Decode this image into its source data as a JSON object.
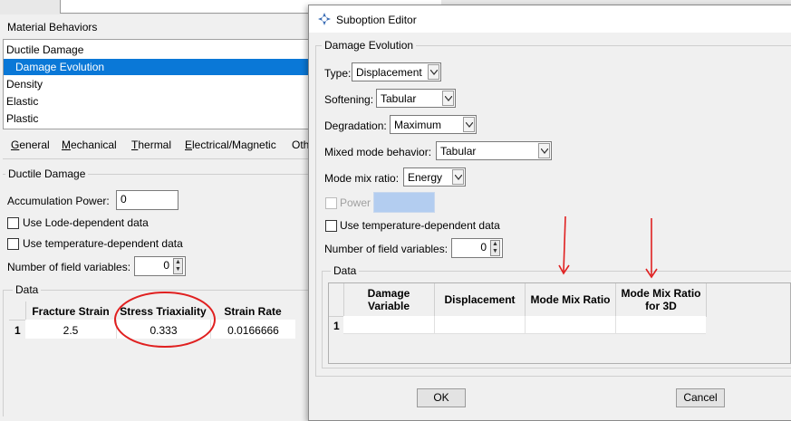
{
  "material": {
    "behaviors_title": "Material Behaviors",
    "behaviors": [
      "Ductile Damage",
      "Damage Evolution",
      "Density",
      "Elastic",
      "Plastic"
    ],
    "selected_index": 1,
    "menus": [
      {
        "u": "G",
        "rest": "eneral"
      },
      {
        "u": "M",
        "rest": "echanical"
      },
      {
        "u": "T",
        "rest": "hermal"
      },
      {
        "u": "E",
        "rest": "lectrical/Magnetic"
      },
      {
        "u": "",
        "rest": "Oth"
      }
    ],
    "section_title": "Ductile Damage",
    "accumulation_label": "Accumulation Power:",
    "accumulation_value": "0",
    "lode_label": "Use Lode-dependent data",
    "temp_label": "Use temperature-dependent data",
    "field_vars_label": "Number of field variables:",
    "field_vars_value": "0",
    "data_title": "Data",
    "table": {
      "headers": [
        "Fracture Strain",
        "Stress Triaxiality",
        "Strain Rate"
      ],
      "rows": [
        {
          "index": "1",
          "cells": [
            "2.5",
            "0.333",
            "0.0166666"
          ]
        }
      ]
    }
  },
  "dialog": {
    "title": "Suboption Editor",
    "group_title": "Damage Evolution",
    "type_label": "Type:",
    "type_value": "Displacement",
    "softening_label": "Softening:",
    "softening_value": "Tabular",
    "degradation_label": "Degradation:",
    "degradation_value": "Maximum",
    "mixed_label": "Mixed mode behavior:",
    "mixed_value": "Tabular",
    "modemix_label": "Mode mix ratio:",
    "modemix_value": "Energy",
    "power_label": "Power",
    "temp_label": "Use temperature-dependent data",
    "field_vars_label": "Number of field variables:",
    "field_vars_value": "0",
    "data_title": "Data",
    "table": {
      "headers": [
        "Damage\nVariable",
        "Displacement",
        "Mode Mix Ratio",
        "Mode Mix Ratio\nfor 3D"
      ],
      "rows": [
        {
          "index": "1"
        }
      ]
    },
    "ok_label": "OK",
    "cancel_label": "Cancel"
  },
  "colors": {
    "selection": "#0a78d7",
    "annotation_red": "#e02020",
    "window_bg": "#f0f0f0"
  }
}
